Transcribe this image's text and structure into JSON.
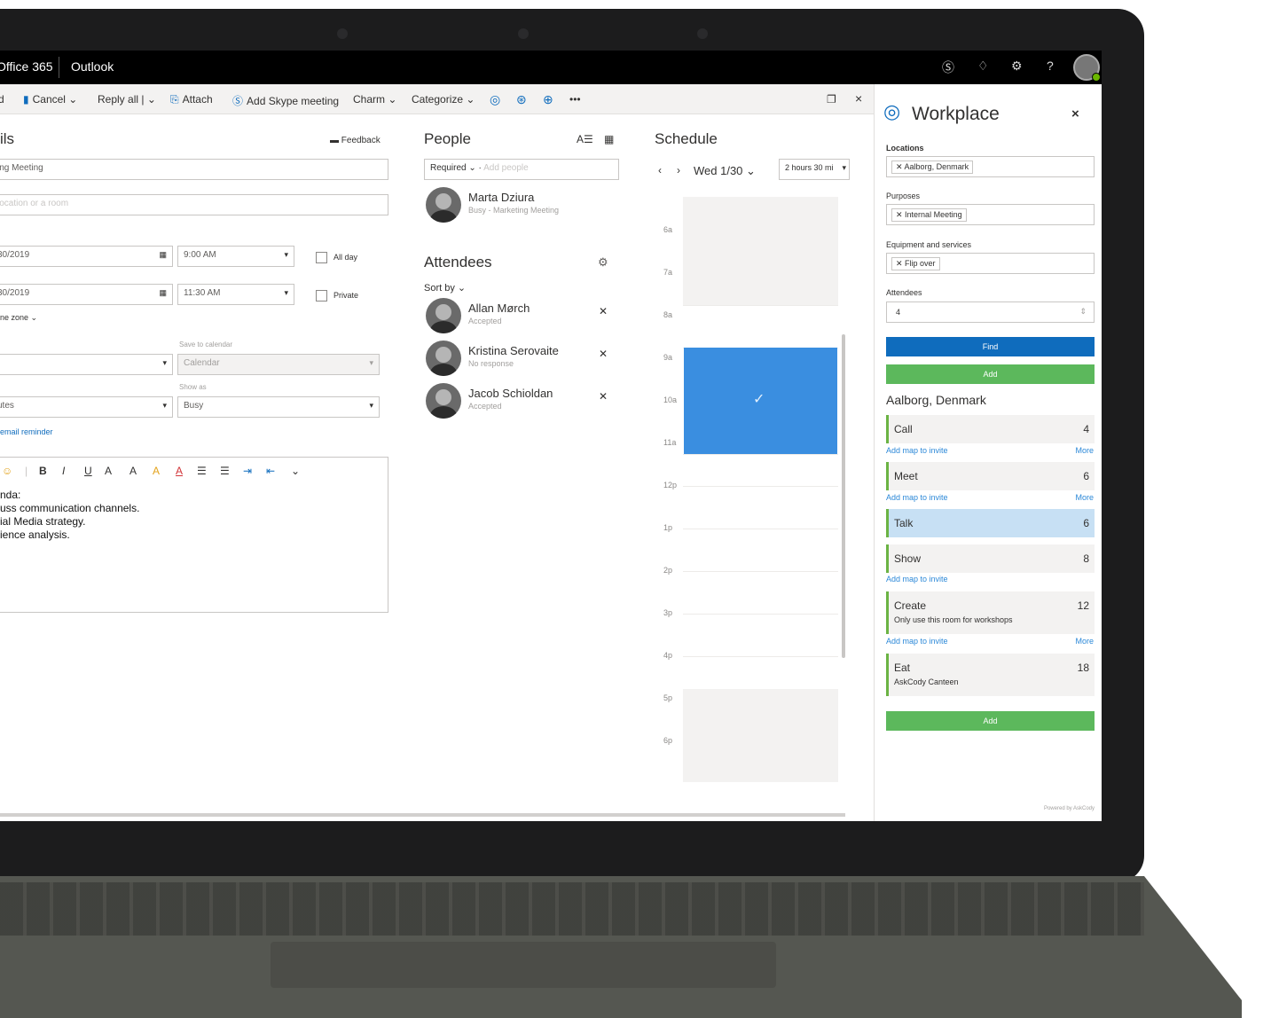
{
  "topbar": {
    "suite": "Office 365",
    "app": "Outlook"
  },
  "toolbar": {
    "cancel": "Cancel",
    "reply_all": "Reply all",
    "attach": "Attach",
    "skype": "Add Skype meeting",
    "charm": "Charm",
    "categorize": "Categorize",
    "more": "•••"
  },
  "details": {
    "title": "ils",
    "feedback": "Feedback",
    "subject": "ing Meeting",
    "location_placeholder": "location or a room",
    "start_date": "30/2019",
    "start_time": "9:00 AM",
    "all_day": "All day",
    "end_date": "30/2019",
    "end_time": "11:30 AM",
    "private": "Private",
    "time_zone": "ne zone",
    "save_to_calendar_label": "Save to calendar",
    "save_to_calendar": "Calendar",
    "show_as_label": "Show as",
    "show_as": "Busy",
    "reminder_value": "utes",
    "email_reminder": "email reminder",
    "body_lines": [
      "nda:",
      "uss communication channels.",
      "ial Media strategy.",
      "ience analysis."
    ]
  },
  "people": {
    "title": "People",
    "required": "Required",
    "add_people_placeholder": "Add people",
    "organizer": {
      "name": "Marta Dziura",
      "status": "Busy - Marketing Meeting"
    },
    "attendees_title": "Attendees",
    "sort_by": "Sort by",
    "attendees": [
      {
        "name": "Allan Mørch",
        "status": "Accepted"
      },
      {
        "name": "Kristina Serovaite",
        "status": "No response"
      },
      {
        "name": "Jacob Schioldan",
        "status": "Accepted"
      }
    ]
  },
  "schedule": {
    "title": "Schedule",
    "date": "Wed 1/30",
    "duration": "2 hours 30 mi",
    "hours": [
      "6a",
      "7a",
      "8a",
      "9a",
      "10a",
      "11a",
      "12p",
      "1p",
      "2p",
      "3p",
      "4p",
      "5p",
      "6p"
    ]
  },
  "workplace": {
    "title": "Workplace",
    "locations_label": "Locations",
    "location_tag": "Aalborg, Denmark",
    "purposes_label": "Purposes",
    "purpose_tag": "Internal Meeting",
    "equipment_label": "Equipment and services",
    "equipment_tag": "Flip over",
    "attendees_label": "Attendees",
    "attendees_value": "4",
    "find": "Find",
    "add": "Add",
    "result_location": "Aalborg, Denmark",
    "rooms": [
      {
        "name": "Call",
        "capacity": "4",
        "link": "Add map to invite",
        "more": "More"
      },
      {
        "name": "Meet",
        "capacity": "6",
        "link": "Add map to invite",
        "more": "More"
      },
      {
        "name": "Talk",
        "capacity": "6"
      },
      {
        "name": "Show",
        "capacity": "8",
        "link": "Add map to invite"
      },
      {
        "name": "Create",
        "capacity": "12",
        "desc": "Only use this room for workshops",
        "link": "Add map to invite",
        "more": "More"
      },
      {
        "name": "Eat",
        "capacity": "18",
        "desc": "AskCody Canteen"
      }
    ],
    "add_bottom": "Add",
    "powered_by": "Powered by AskCody"
  },
  "colors": {
    "find": "#0f6cbd",
    "add": "#5cb85c",
    "slot": "#3a8ee0",
    "room_accent": "#6bb344",
    "selected_room": "#c7e0f4"
  }
}
